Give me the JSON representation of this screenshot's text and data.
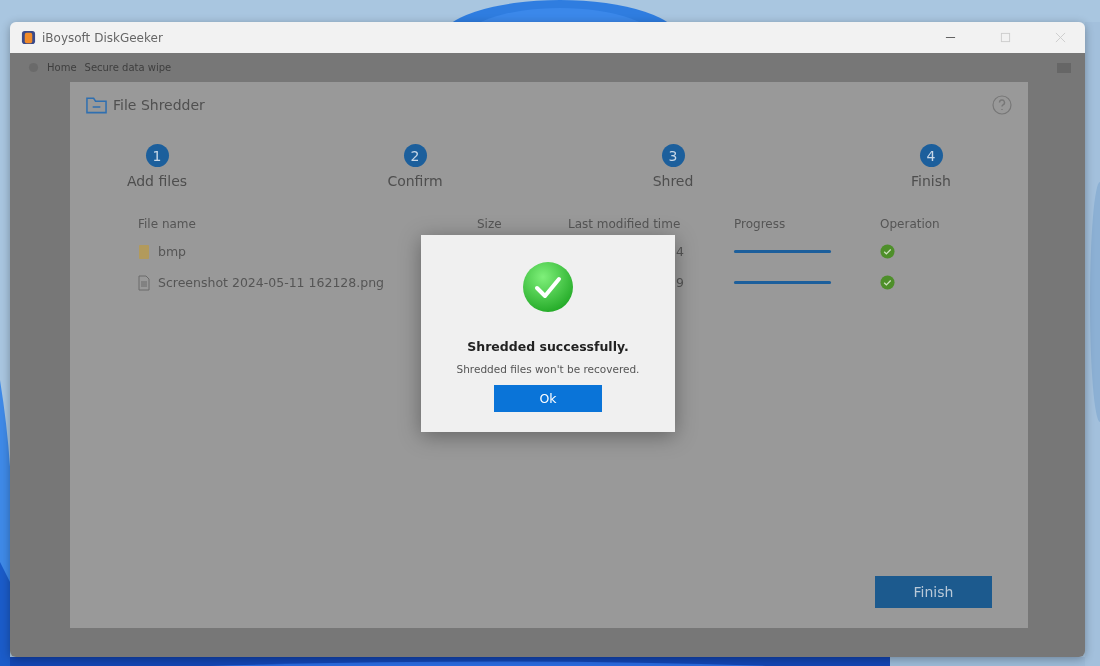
{
  "window": {
    "title": "iBoysoft DiskGeeker"
  },
  "breadcrumb": [
    "Home",
    "Secure data wipe"
  ],
  "panel": {
    "title": "File Shredder"
  },
  "steps": [
    {
      "number": "1",
      "label": "Add files"
    },
    {
      "number": "2",
      "label": "Confirm"
    },
    {
      "number": "3",
      "label": "Shred"
    },
    {
      "number": "4",
      "label": "Finish"
    }
  ],
  "table": {
    "columns": [
      "File name",
      "Size",
      "Last modified time",
      "Progress",
      "Operation"
    ],
    "rows": [
      {
        "kind": "folder",
        "name": "bmp",
        "time": "4",
        "level": 1,
        "done": true
      },
      {
        "kind": "file",
        "name": "Screenshot 2024-05-11 162128.png",
        "time": "9",
        "level": 1,
        "done": true
      }
    ]
  },
  "finish_button": "Finish",
  "dialog": {
    "title": "Shredded successfully.",
    "message": "Shredded files won't be recovered.",
    "button": "Ok"
  }
}
